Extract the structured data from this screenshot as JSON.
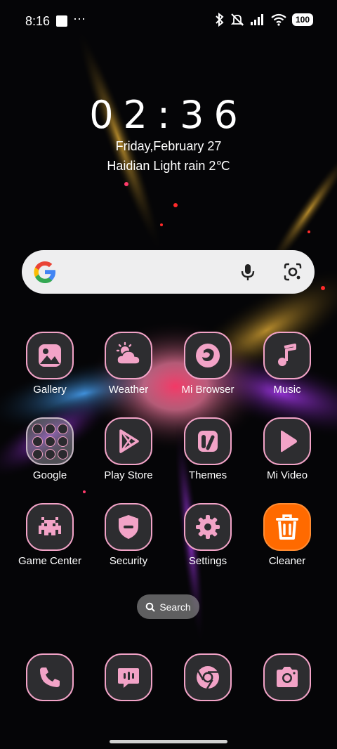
{
  "status_bar": {
    "time": "8:16",
    "battery": "100"
  },
  "lock_widget": {
    "clock": "02:36",
    "date": "Friday,February 27",
    "weather": "Haidian Light rain 2℃"
  },
  "search_bar": {
    "logo": "google-g-icon",
    "mic": "mic-icon",
    "lens": "lens-icon"
  },
  "apps_row1": [
    {
      "label": "Gallery",
      "icon": "gallery-icon"
    },
    {
      "label": "Weather",
      "icon": "weather-icon"
    },
    {
      "label": "Mi Browser",
      "icon": "browser-icon"
    },
    {
      "label": "Music",
      "icon": "music-icon"
    }
  ],
  "apps_row2": [
    {
      "label": "Google",
      "icon": "folder-icon"
    },
    {
      "label": "Play Store",
      "icon": "play-store-icon"
    },
    {
      "label": "Themes",
      "icon": "themes-icon"
    },
    {
      "label": "Mi Video",
      "icon": "play-icon"
    }
  ],
  "apps_row3": [
    {
      "label": "Game Center",
      "icon": "game-icon"
    },
    {
      "label": "Security",
      "icon": "shield-icon"
    },
    {
      "label": "Settings",
      "icon": "gear-icon"
    },
    {
      "label": "Cleaner",
      "icon": "trash-icon"
    }
  ],
  "app_search": {
    "label": "Search"
  },
  "dock": [
    {
      "name": "phone",
      "icon": "phone-icon"
    },
    {
      "name": "messages",
      "icon": "message-icon"
    },
    {
      "name": "chrome",
      "icon": "chrome-icon"
    },
    {
      "name": "camera",
      "icon": "camera-icon"
    }
  ],
  "colors": {
    "icon_accent": "#f2a3c7",
    "icon_bg": "#2d2d30",
    "cleaner": "#ff6a00"
  }
}
